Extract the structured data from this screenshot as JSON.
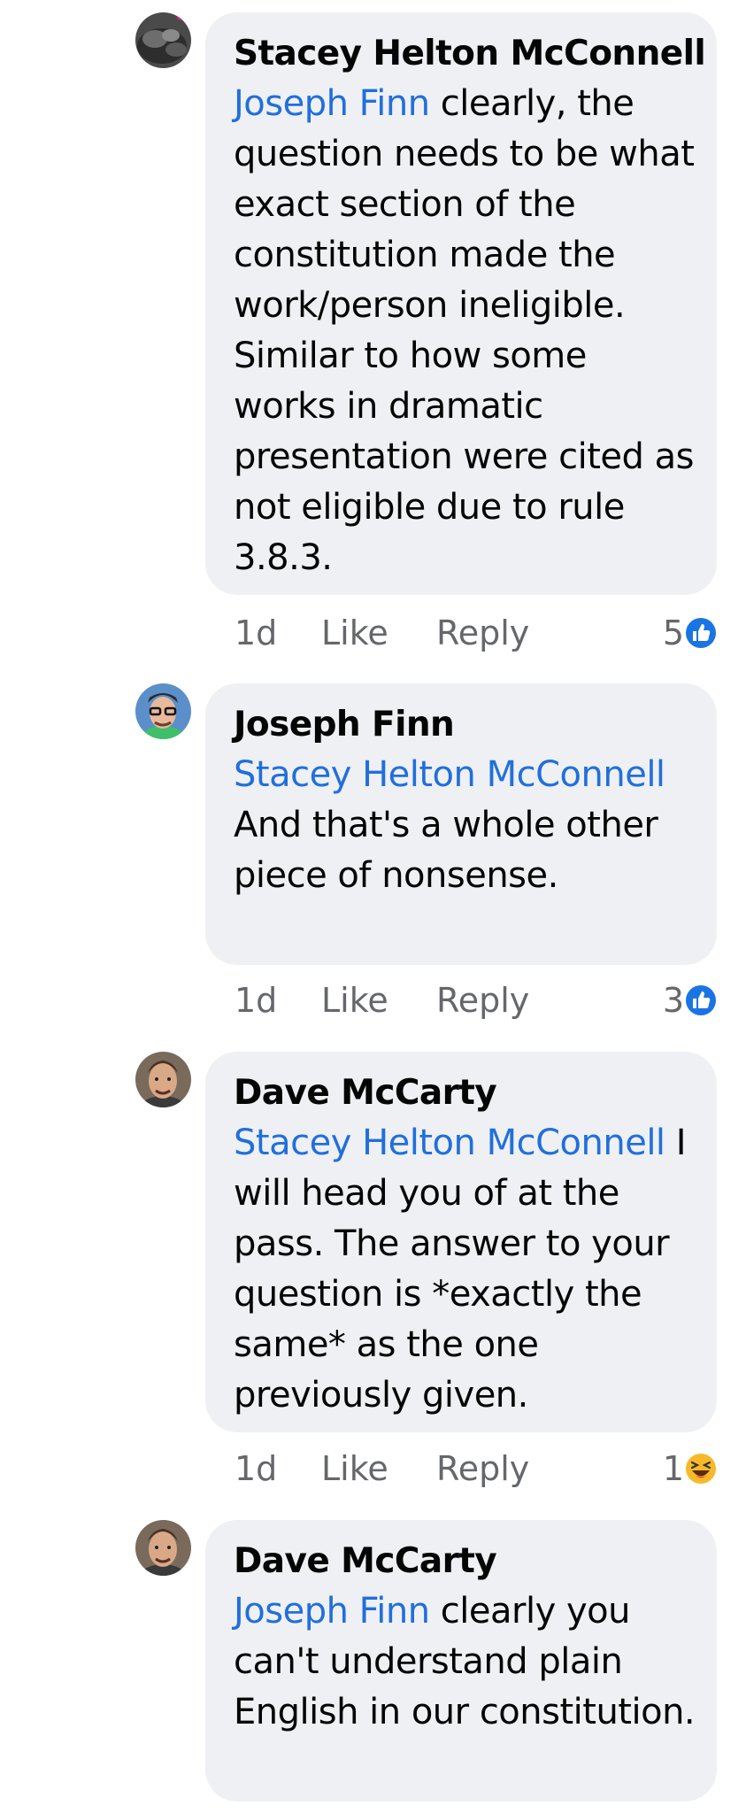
{
  "comments": [
    {
      "author": "Stacey Helton McConnell",
      "mention": "Joseph Finn",
      "text": " clearly, the question needs to be what exact section of the constitution made the work/person ineligible.  Similar to how some works in dramatic presentation were cited as not eligible due to rule 3.8.3.",
      "time": "1d",
      "like_label": "Like",
      "reply_label": "Reply",
      "reaction_count": "5",
      "reaction_icon": "like-icon",
      "avatar_icon": "cat-avatar"
    },
    {
      "author": "Joseph Finn",
      "mention": "Stacey Helton McConnell",
      "text": " And that's a whole other piece of nonsense.",
      "time": "1d",
      "like_label": "Like",
      "reply_label": "Reply",
      "reaction_count": "3",
      "reaction_icon": "like-icon",
      "avatar_icon": "man-glasses-avatar"
    },
    {
      "author": "Dave McCarty",
      "mention": "Stacey Helton McConnell",
      "text": " I will head you of at the pass.  The answer to your question is *exactly the same* as the one previously given.",
      "time": "1d",
      "like_label": "Like",
      "reply_label": "Reply",
      "reaction_count": "1",
      "reaction_icon": "haha-icon",
      "avatar_icon": "man-avatar"
    },
    {
      "author": "Dave McCarty",
      "mention": "Joseph Finn",
      "text": " clearly you can't understand plain English in our constitution.",
      "avatar_icon": "man-avatar"
    }
  ],
  "colors": {
    "mention": "#216fdb",
    "bubble": "#eff0f4",
    "meta": "#65676b",
    "like_blue": "#1b74e4",
    "haha_yellow": "#f7b928"
  }
}
